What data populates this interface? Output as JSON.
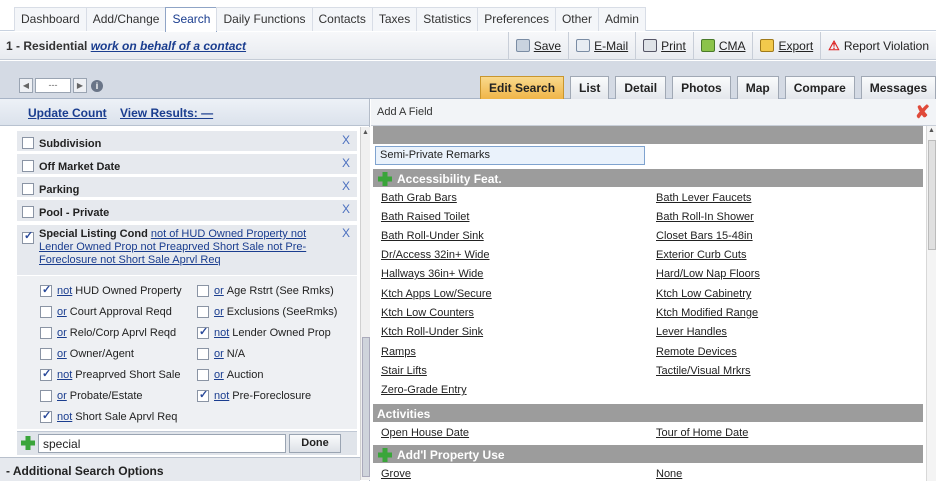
{
  "nav": {
    "tabs": [
      "Dashboard",
      "Add/Change",
      "Search",
      "Daily Functions",
      "Contacts",
      "Taxes",
      "Statistics",
      "Preferences",
      "Other",
      "Admin"
    ],
    "active": "Search"
  },
  "header": {
    "title_prefix": "1 - Residential",
    "title_link": "work on behalf of a contact"
  },
  "actions": {
    "save": "Save",
    "email": "E-Mail",
    "print": "Print",
    "cma": "CMA",
    "export": "Export",
    "report": "Report Violation"
  },
  "pager": {
    "prev": "◀",
    "field": "---",
    "next": "▶",
    "info": "i"
  },
  "tabs": [
    "Edit Search",
    "List",
    "Detail",
    "Photos",
    "Map",
    "Compare",
    "Messages"
  ],
  "left": {
    "update_count": "Update Count",
    "view_results": "View Results: —",
    "close_x": "X",
    "criteria": [
      "Subdivision",
      "Off Market Date",
      "Parking",
      "Pool - Private"
    ],
    "special": {
      "label": "Special Listing Cond",
      "summary": "not of HUD Owned Property not Lender Owned Prop not Preaprved Short Sale not Pre-Foreclosure not Short Sale Aprvl Req"
    },
    "options": [
      {
        "prefix": "not",
        "label": "HUD Owned Property",
        "checked": true
      },
      {
        "prefix": "or",
        "label": "Age Rstrt (See Rmks)",
        "checked": false
      },
      {
        "prefix": "or",
        "label": "Court Approval Reqd",
        "checked": false
      },
      {
        "prefix": "or",
        "label": "Exclusions (SeeRmks)",
        "checked": false
      },
      {
        "prefix": "or",
        "label": "Relo/Corp Aprvl Reqd",
        "checked": false
      },
      {
        "prefix": "not",
        "label": "Lender Owned Prop",
        "checked": true
      },
      {
        "prefix": "or",
        "label": "Owner/Agent",
        "checked": false
      },
      {
        "prefix": "or",
        "label": "N/A",
        "checked": false
      },
      {
        "prefix": "not",
        "label": "Preaprved Short Sale",
        "checked": true
      },
      {
        "prefix": "or",
        "label": "Auction",
        "checked": false
      },
      {
        "prefix": "or",
        "label": "Probate/Estate",
        "checked": false
      },
      {
        "prefix": "not",
        "label": "Pre-Foreclosure",
        "checked": true
      },
      {
        "prefix": "not",
        "label": "Short Sale Aprvl Req",
        "checked": true
      }
    ],
    "search_value": "special",
    "done": "Done",
    "additional": "- Additional Search Options"
  },
  "right": {
    "title": "Add A Field",
    "selected": "Semi-Private Remarks",
    "sections": [
      {
        "name": "Accessibility Feat.",
        "items": [
          "Bath Grab Bars",
          "Bath Lever Faucets",
          "Bath Raised Toilet",
          "Bath Roll-In Shower",
          "Bath Roll-Under Sink",
          "Closet Bars 15-48in",
          "Dr/Access 32in+ Wide",
          "Exterior Curb Cuts",
          "Hallways 36in+ Wide",
          "Hard/Low Nap Floors",
          "Ktch Apps Low/Secure",
          "Ktch Low Cabinetry",
          "Ktch Low Counters",
          "Ktch Modified Range",
          "Ktch Roll-Under Sink",
          "Lever Handles",
          "Ramps",
          "Remote Devices",
          "Stair Lifts",
          "Tactile/Visual Mrkrs",
          "Zero-Grade Entry"
        ]
      },
      {
        "name": "Activities",
        "items": [
          "Open House Date",
          "Tour of Home Date"
        ]
      },
      {
        "name": "Add'l Property Use",
        "items": [
          "Grove",
          "None"
        ]
      }
    ]
  },
  "colors": {
    "link": "#1a3d8f",
    "active_tab": "#f0b548",
    "section_bg": "#9c9c9c",
    "plus_green": "#3aa53a",
    "close_red": "#e04a3a"
  }
}
